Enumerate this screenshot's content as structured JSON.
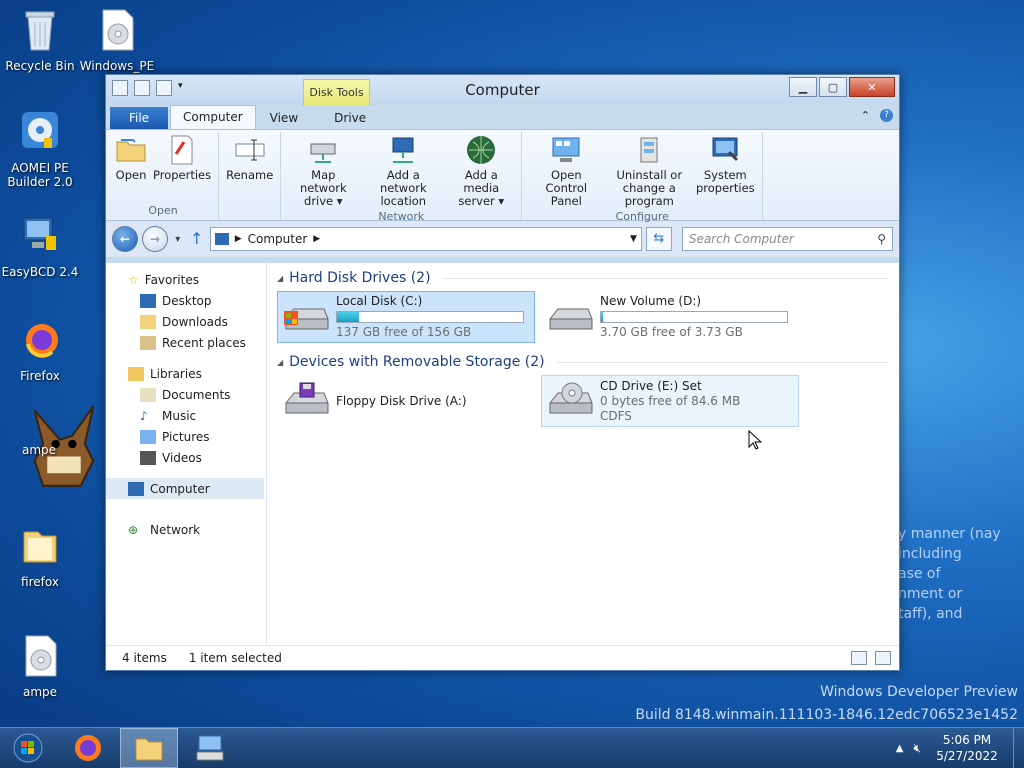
{
  "desktop": {
    "icons": [
      {
        "label": "Recycle Bin"
      },
      {
        "label": "Windows_PE"
      },
      {
        "label": "AOMEI PE Builder 2.0"
      },
      {
        "label": "EasyBCD 2.4"
      },
      {
        "label": "Firefox"
      },
      {
        "label": "ampe"
      },
      {
        "label": "firefox"
      },
      {
        "label": "ampe"
      }
    ],
    "watermark_line1": "Windows Developer Preview",
    "watermark_line2": "Build 8148.winmain.111103-1846.12edc706523e1452",
    "ghost_text": [
      "y manner (nay",
      "including",
      "ase of",
      "nment or",
      "taff), and"
    ]
  },
  "window": {
    "title": "Computer",
    "contextual_group": "Disk Tools",
    "tabs": [
      "File",
      "Computer",
      "View",
      "Drive"
    ],
    "active_tab": "Computer",
    "ribbon": {
      "groups": [
        {
          "label": "Open",
          "buttons": [
            "Open",
            "Properties"
          ]
        },
        {
          "label": "",
          "buttons": [
            "Rename"
          ]
        },
        {
          "label": "Network",
          "buttons": [
            "Map network drive ▾",
            "Add a network location",
            "Add a media server ▾"
          ]
        },
        {
          "label": "Configure",
          "buttons": [
            "Open Control Panel",
            "Uninstall or change a program",
            "System properties"
          ]
        }
      ]
    },
    "address": {
      "crumb": "Computer",
      "search_placeholder": "Search Computer"
    },
    "nav": {
      "favorites": "Favorites",
      "favorites_items": [
        "Desktop",
        "Downloads",
        "Recent places"
      ],
      "libraries": "Libraries",
      "libraries_items": [
        "Documents",
        "Music",
        "Pictures",
        "Videos"
      ],
      "computer": "Computer",
      "network": "Network"
    },
    "content": {
      "hdd_header": "Hard Disk Drives (2)",
      "drives": [
        {
          "name": "Local Disk (C:)",
          "free": "137 GB free of 156 GB",
          "used_fraction": 0.12
        },
        {
          "name": "New Volume (D:)",
          "free": "3.70 GB free of 3.73 GB",
          "used_fraction": 0.01
        }
      ],
      "removable_header": "Devices with Removable Storage (2)",
      "removable": [
        {
          "name": "Floppy Disk Drive (A:)"
        },
        {
          "name": "CD Drive (E:) Set",
          "free": "0 bytes free of 84.6 MB",
          "fs": "CDFS"
        }
      ]
    },
    "status": {
      "items": "4 items",
      "selected": "1 item selected"
    }
  },
  "taskbar": {
    "time": "5:06 PM",
    "date": "5/27/2022"
  }
}
